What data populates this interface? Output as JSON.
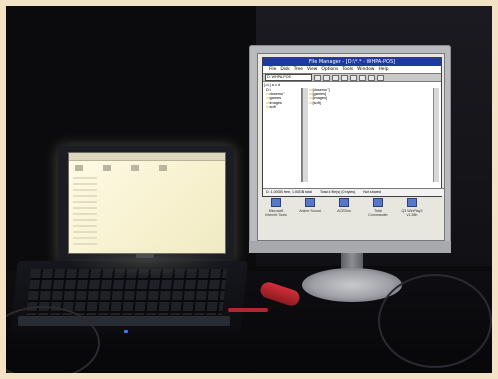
{
  "monitor": {
    "window_title": "File Manager - [D:\\*.* - WHPA-POS]",
    "menu": [
      "File",
      "Disk",
      "Tree",
      "View",
      "Options",
      "Tools",
      "Window",
      "Help"
    ],
    "drive_select": "D: WHPA-POS",
    "drivebar": "[-d-]  a  c  d",
    "tree_items": [
      "D:\\",
      "dosemu\"",
      "games",
      "images",
      "soft"
    ],
    "file_items": [
      "[dosemu\"]",
      "[games]",
      "[images]",
      "[soft]"
    ],
    "status": {
      "left": "D: 1.00GB free,  1.00GB total",
      "middle": "Total 4 file(s) (0 bytes)",
      "right": "Not shared"
    },
    "desktop_icons": [
      {
        "label": "Microsoft Internet Tools"
      },
      {
        "label": "Anime Sound"
      },
      {
        "label": "ACEDos"
      },
      {
        "label": "Total Commander"
      },
      {
        "label": "Q3 WinPlay3 v1.36b"
      }
    ]
  }
}
